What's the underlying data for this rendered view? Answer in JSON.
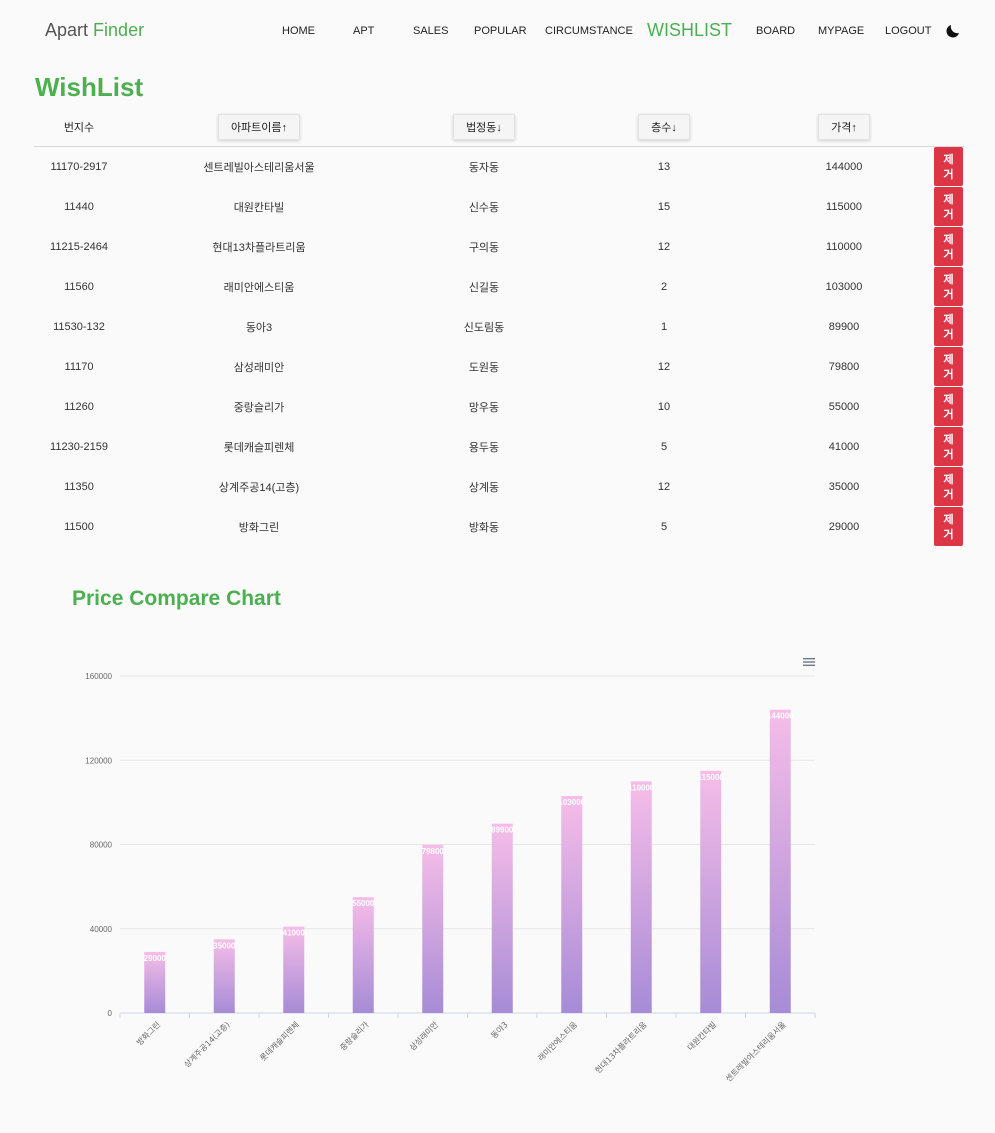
{
  "nav": {
    "brand_part1": "Apart",
    "brand_part2": "Finder",
    "items": [
      {
        "label": "HOME",
        "active": false
      },
      {
        "label": "APT",
        "active": false
      },
      {
        "label": "SALES",
        "active": false
      },
      {
        "label": "POPULAR",
        "active": false
      },
      {
        "label": "CIRCUMSTANCE",
        "active": false
      },
      {
        "label": "WISHLIST",
        "active": true
      },
      {
        "label": "BOARD",
        "active": false
      },
      {
        "label": "MYPAGE",
        "active": false
      },
      {
        "label": "LOGOUT",
        "active": false
      }
    ],
    "theme_icon": "moon-icon"
  },
  "page": {
    "title": "WishList"
  },
  "table": {
    "headers": {
      "lot": "번지수",
      "name": "아파트이름↑",
      "dong": "법정동↓",
      "floor": "층수↓",
      "price": "가격↑"
    },
    "remove_label": "제거",
    "rows": [
      {
        "lot": "11170-2917",
        "name": "센트레빌아스테리움서울",
        "dong": "동자동",
        "floor": "13",
        "price": "144000"
      },
      {
        "lot": "11440",
        "name": "대원칸타빌",
        "dong": "신수동",
        "floor": "15",
        "price": "115000"
      },
      {
        "lot": "11215-2464",
        "name": "현대13차플라트리움",
        "dong": "구의동",
        "floor": "12",
        "price": "110000"
      },
      {
        "lot": "11560",
        "name": "래미안에스티움",
        "dong": "신길동",
        "floor": "2",
        "price": "103000"
      },
      {
        "lot": "11530-132",
        "name": "동아3",
        "dong": "신도림동",
        "floor": "1",
        "price": "89900"
      },
      {
        "lot": "11170",
        "name": "삼성래미안",
        "dong": "도원동",
        "floor": "12",
        "price": "79800"
      },
      {
        "lot": "11260",
        "name": "중랑슬리가",
        "dong": "망우동",
        "floor": "10",
        "price": "55000"
      },
      {
        "lot": "11230-2159",
        "name": "롯데캐슬피렌체",
        "dong": "용두동",
        "floor": "5",
        "price": "41000"
      },
      {
        "lot": "11350",
        "name": "상계주공14(고층)",
        "dong": "상계동",
        "floor": "12",
        "price": "35000"
      },
      {
        "lot": "11500",
        "name": "방화그린",
        "dong": "방화동",
        "floor": "5",
        "price": "29000"
      }
    ]
  },
  "chart": {
    "heading": "Price Compare Chart",
    "menu_icon": "hamburger-menu-icon",
    "colors": {
      "top": "#f6bde8",
      "bottom": "#a68bd6",
      "title": "#4caf50",
      "remove": "#dc3545"
    }
  },
  "chart_data": {
    "type": "bar",
    "categories": [
      "방화그린",
      "상계주공14(고층)",
      "롯데캐슬피렌체",
      "중랑슬리가",
      "삼성래미안",
      "동아3",
      "래미안에스티움",
      "현대13차플라트리움",
      "대원칸타빌",
      "센트레빌아스테리움서울"
    ],
    "values": [
      29000,
      35000,
      41000,
      55000,
      79800,
      89900,
      103000,
      110000,
      115000,
      144000
    ],
    "ylim": [
      0,
      160000
    ],
    "yticks": [
      0,
      40000,
      80000,
      120000,
      160000
    ],
    "grid": true,
    "title": "",
    "xlabel": "",
    "ylabel": ""
  }
}
